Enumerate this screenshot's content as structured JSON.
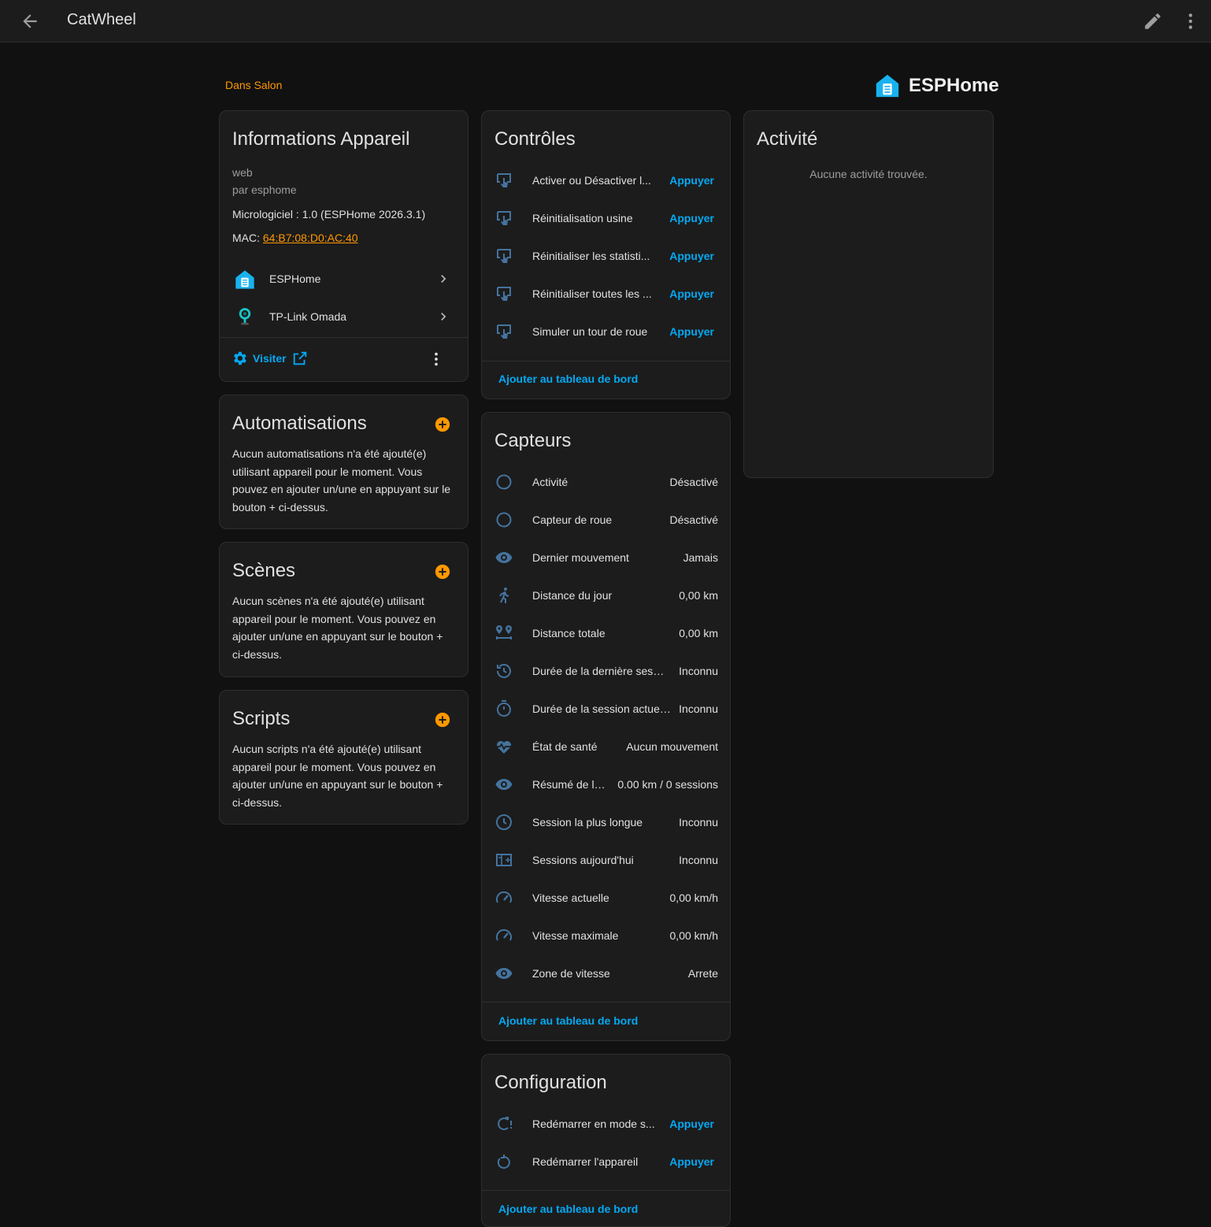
{
  "header": {
    "title": "CatWheel",
    "back_icon": "arrow-left-icon",
    "edit_icon": "pencil-icon",
    "menu_icon": "dots-vertical-icon"
  },
  "area": "Dans Salon",
  "brand": {
    "name": "ESPHome",
    "color": "#18b2f0"
  },
  "device_info": {
    "title": "Informations Appareil",
    "model": "web",
    "manufacturer": "par esphome",
    "firmware": "Micrologiciel : 1.0 (ESPHome 2026.3.1)",
    "mac_label": "MAC:",
    "mac_value": "64:B7:08:D0:AC:40",
    "integrations": [
      {
        "label": "ESPHome",
        "icon": "esphome-icon"
      },
      {
        "label": "TP-Link Omada",
        "icon": "omada-icon"
      }
    ],
    "visit_label": "Visiter"
  },
  "automations": {
    "title": "Automatisations",
    "empty": "Aucun automatisations n'a été ajouté(e) utilisant appareil pour le moment. Vous pouvez en ajouter un/une en appuyant sur le bouton + ci-dessus."
  },
  "scenes": {
    "title": "Scènes",
    "empty": "Aucun scènes n'a été ajouté(e) utilisant appareil pour le moment. Vous pouvez en ajouter un/une en appuyant sur le bouton + ci-dessus."
  },
  "scripts": {
    "title": "Scripts",
    "empty": "Aucun scripts n'a été ajouté(e) utilisant appareil pour le moment. Vous pouvez en ajouter un/une en appuyant sur le bouton + ci-dessus."
  },
  "controls": {
    "title": "Contrôles",
    "rows": [
      {
        "name": "Activer ou Désactiver l...",
        "action": "Appuyer",
        "icon": "gesture-tap-button-icon"
      },
      {
        "name": "Réinitialisation usine",
        "action": "Appuyer",
        "icon": "gesture-tap-button-icon"
      },
      {
        "name": "Réinitialiser les statisti...",
        "action": "Appuyer",
        "icon": "gesture-tap-button-icon"
      },
      {
        "name": "Réinitialiser toutes les ...",
        "action": "Appuyer",
        "icon": "gesture-tap-button-icon"
      },
      {
        "name": "Simuler un tour de roue",
        "action": "Appuyer",
        "icon": "gesture-tap-button-icon"
      }
    ],
    "add_label": "Ajouter au tableau de bord"
  },
  "sensors": {
    "title": "Capteurs",
    "rows": [
      {
        "name": "Activité",
        "value": "Désactivé",
        "icon": "radiobox-blank-icon"
      },
      {
        "name": "Capteur de roue",
        "value": "Désactivé",
        "icon": "radiobox-blank-icon"
      },
      {
        "name": "Dernier mouvement",
        "value": "Jamais",
        "icon": "eye-icon"
      },
      {
        "name": "Distance du jour",
        "value": "0,00 km",
        "icon": "run-icon"
      },
      {
        "name": "Distance totale",
        "value": "0,00 km",
        "icon": "map-marker-distance-icon"
      },
      {
        "name": "Durée de la dernière sessi...",
        "value": "Inconnu",
        "icon": "history-icon"
      },
      {
        "name": "Durée de la session actuel...",
        "value": "Inconnu",
        "icon": "timer-icon"
      },
      {
        "name": "État de santé",
        "value": "Aucun mouvement",
        "icon": "heart-pulse-icon"
      },
      {
        "name": "Résumé de la...",
        "value": "0.00 km / 0 sessions",
        "icon": "eye-icon"
      },
      {
        "name": "Session la plus longue",
        "value": "Inconnu",
        "icon": "clock-icon"
      },
      {
        "name": "Sessions aujourd'hui",
        "value": "Inconnu",
        "icon": "counter-icon"
      },
      {
        "name": "Vitesse actuelle",
        "value": "0,00 km/h",
        "icon": "speedometer-icon"
      },
      {
        "name": "Vitesse maximale",
        "value": "0,00 km/h",
        "icon": "speedometer-icon"
      },
      {
        "name": "Zone de vitesse",
        "value": "Arrete",
        "icon": "eye-icon"
      }
    ],
    "add_label": "Ajouter au tableau de bord"
  },
  "configuration": {
    "title": "Configuration",
    "rows": [
      {
        "name": "Redémarrer en mode s...",
        "action": "Appuyer",
        "icon": "restart-alert-icon"
      },
      {
        "name": "Redémarrer l'appareil",
        "action": "Appuyer",
        "icon": "restart-icon"
      }
    ],
    "add_label": "Ajouter au tableau de bord"
  },
  "activity": {
    "title": "Activité",
    "empty": "Aucune activité trouvée."
  },
  "colors": {
    "accent": "#03a9f4",
    "orange": "#ff9800",
    "icon": "#44739e"
  }
}
